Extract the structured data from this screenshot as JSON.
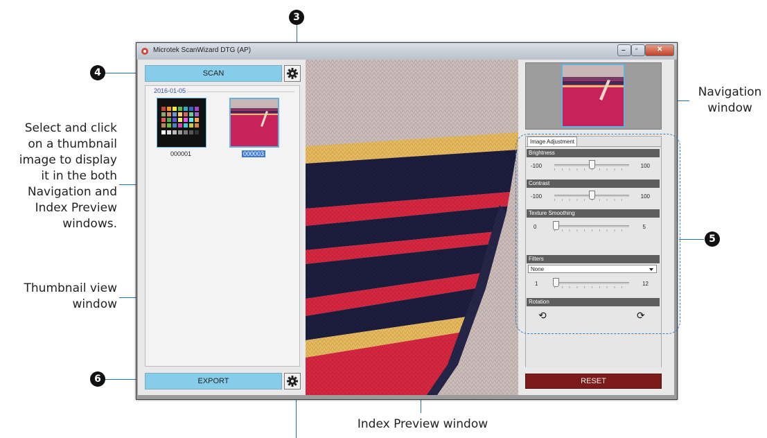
{
  "window": {
    "title": "Microtek ScanWizard DTG (AP)",
    "title_icon": "app-icon",
    "controls": [
      "minimize-icon",
      "maximize-icon",
      "close-icon"
    ]
  },
  "toolbar": {
    "scan_label": "SCAN",
    "export_label": "EXPORT",
    "scan_settings_icon": "gear-icon",
    "export_settings_icon": "gear-icon"
  },
  "thumbnails": {
    "group_date": "2016-01-05",
    "items": [
      {
        "caption": "000001",
        "selected": false
      },
      {
        "caption": "000003",
        "selected": true
      }
    ]
  },
  "adjustments": {
    "tab_label": "Image Adjustment",
    "brightness": {
      "label": "Brightness",
      "min": "-100",
      "max": "100",
      "value": 0
    },
    "contrast": {
      "label": "Contrast",
      "min": "-100",
      "max": "100",
      "value": 0
    },
    "texture": {
      "label": "Texture Smoothing",
      "min": "0",
      "max": "5",
      "value": 0
    },
    "filters": {
      "label": "Filters",
      "selected": "None",
      "min": "1",
      "max": "12",
      "value": 1
    },
    "rotation": {
      "label": "Rotation",
      "ccw_icon": "rotate-ccw-icon",
      "cw_icon": "rotate-cw-icon"
    }
  },
  "reset_label": "RESET",
  "callouts": {
    "n3": "3",
    "n4": "4",
    "n5": "5",
    "n6": "6",
    "navigation_line1": "Navigation",
    "navigation_line2": "window",
    "select_line1": "Select and click",
    "select_line2": "on a thumbnail",
    "select_line3": "image to display",
    "select_line4": "it in the both",
    "select_line5": "Navigation and",
    "select_line6": "Index Preview",
    "select_line7": "windows.",
    "thumbview_line1": "Thumbnail view",
    "thumbview_line2": "window",
    "index_preview": "Index Preview window"
  },
  "colors": {
    "scan_button": "#86cdea",
    "reset_button": "#7d1a1a",
    "callout_line": "#1e6fb0"
  }
}
